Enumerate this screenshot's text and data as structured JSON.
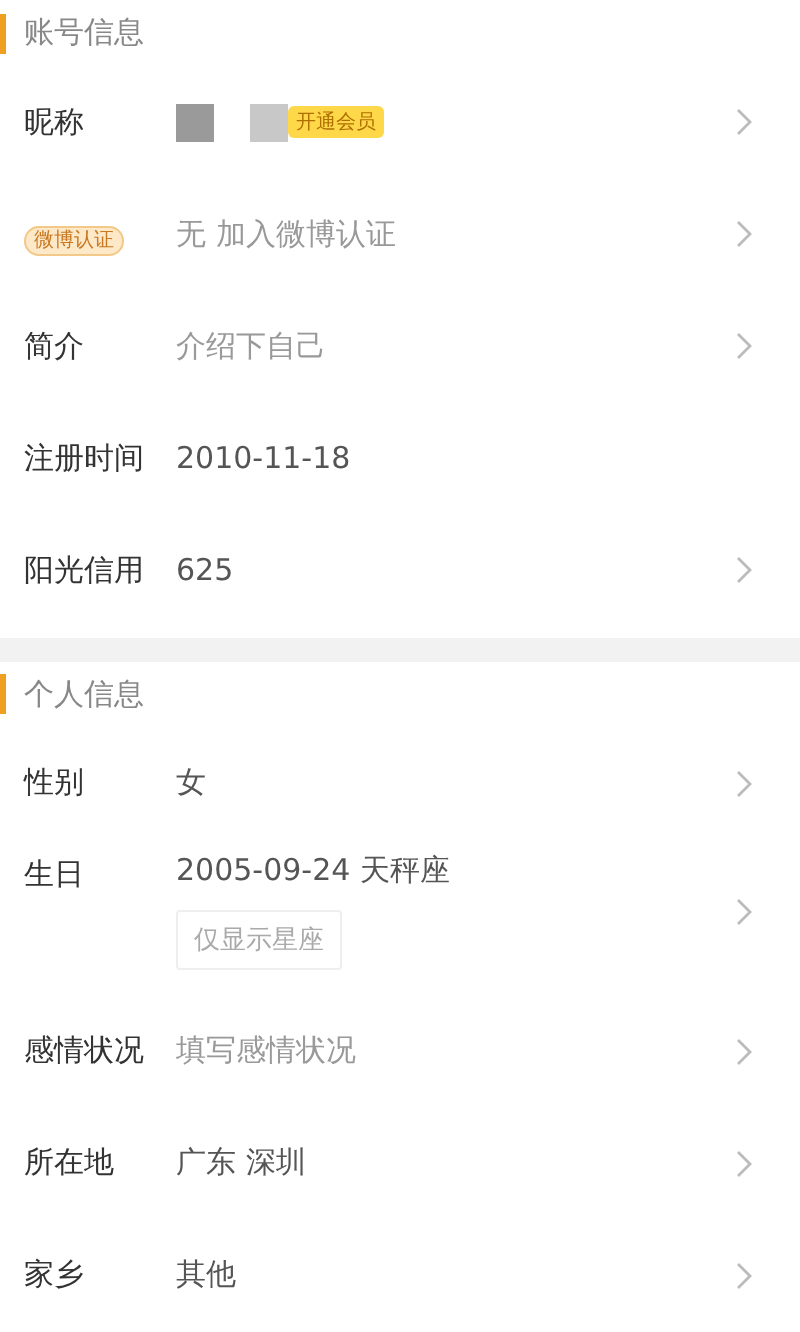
{
  "sections": [
    {
      "title": "账号信息",
      "gap_before": false,
      "rows": [
        {
          "kind": "nickname",
          "label": "昵称",
          "badge": "开通会员",
          "chevron": true
        },
        {
          "kind": "tag",
          "tag": "微博认证",
          "value": "无 加入微博认证",
          "muted": true,
          "chevron": true
        },
        {
          "kind": "text",
          "label": "简介",
          "value": "介绍下自己",
          "muted": true,
          "chevron": true
        },
        {
          "kind": "text",
          "label": "注册时间",
          "value": "2010-11-18",
          "muted": false,
          "chevron": false
        },
        {
          "kind": "text",
          "label": "阳光信用",
          "value": "625",
          "muted": false,
          "chevron": true
        }
      ]
    },
    {
      "title": "个人信息",
      "gap_before": true,
      "rows": [
        {
          "kind": "text",
          "label": "性别",
          "value": "女",
          "muted": false,
          "chevron": true
        },
        {
          "kind": "text",
          "label": "生日",
          "value": "2005-09-24 天秤座",
          "muted": false,
          "chevron": true,
          "option": "仅显示星座"
        },
        {
          "kind": "text",
          "label": "感情状况",
          "value": "填写感情状况",
          "muted": true,
          "chevron": true
        },
        {
          "kind": "text",
          "label": "所在地",
          "value": "广东 深圳",
          "muted": false,
          "chevron": true
        },
        {
          "kind": "text",
          "label": "家乡",
          "value": "其他",
          "muted": false,
          "chevron": true
        }
      ]
    }
  ]
}
